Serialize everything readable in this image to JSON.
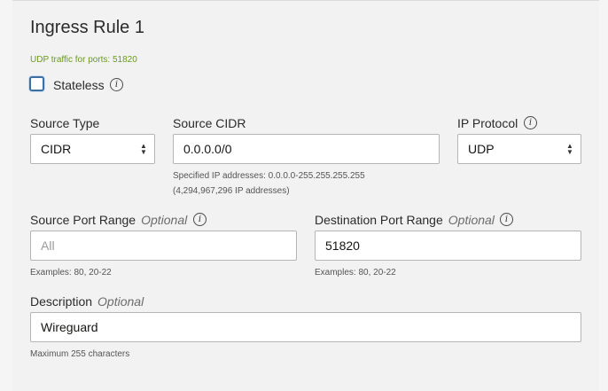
{
  "rule": {
    "title": "Ingress Rule 1",
    "summary": "UDP traffic for ports: 51820",
    "stateless_label": "Stateless",
    "stateless_checked": false
  },
  "source_type": {
    "label": "Source Type",
    "value": "CIDR"
  },
  "source_cidr": {
    "label": "Source CIDR",
    "value": "0.0.0.0/0",
    "help_line1": "Specified IP addresses: 0.0.0.0-255.255.255.255",
    "help_line2": "(4,294,967,296 IP addresses)"
  },
  "ip_protocol": {
    "label": "IP Protocol",
    "value": "UDP"
  },
  "source_port": {
    "label": "Source Port Range",
    "optional": "Optional",
    "placeholder": "All",
    "help": "Examples: 80, 20-22"
  },
  "dest_port": {
    "label": "Destination Port Range",
    "optional": "Optional",
    "value": "51820",
    "help": "Examples: 80, 20-22"
  },
  "description": {
    "label": "Description",
    "optional": "Optional",
    "value": "Wireguard",
    "help": "Maximum 255 characters"
  },
  "icons": {
    "info": "info-icon",
    "select": "chevron-up-down-icon"
  }
}
